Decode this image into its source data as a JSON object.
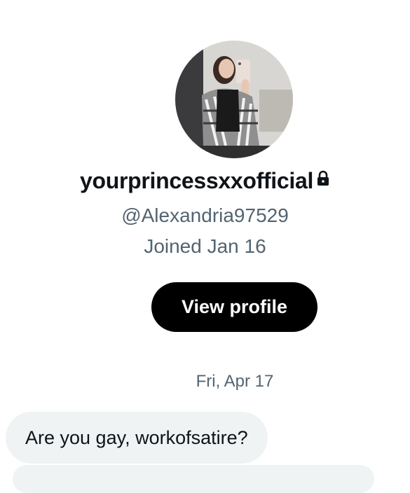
{
  "profile": {
    "display_name": "yourprincessxxofficial",
    "handle": "@Alexandria97529",
    "joined": "Joined Jan 16",
    "view_profile_label": "View profile",
    "locked_icon": "lock-icon",
    "avatar": "profile-photo"
  },
  "conversation": {
    "date_separator": "Fri, Apr 17",
    "messages": [
      {
        "text": "Are you gay, workofsatire?"
      }
    ]
  },
  "colors": {
    "primary_text": "#0f1419",
    "secondary_text": "#536471",
    "button_bg": "#000000",
    "bubble_bg": "#eff3f4"
  }
}
